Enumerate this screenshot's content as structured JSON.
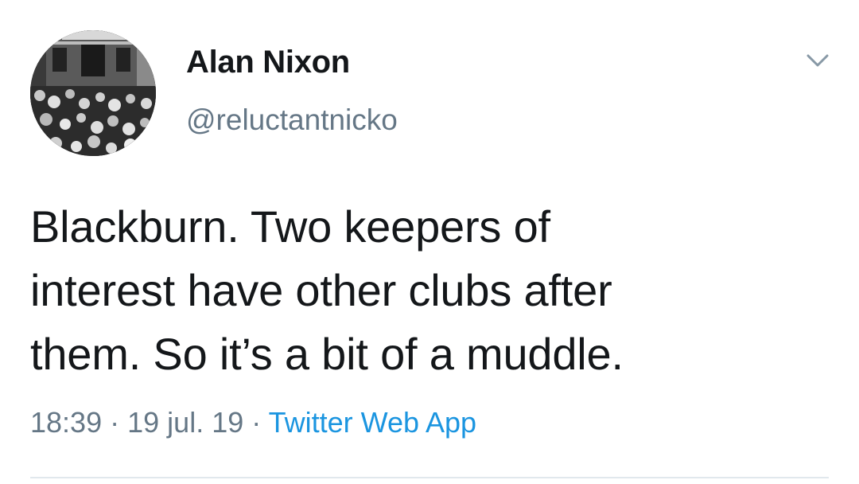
{
  "author": {
    "display_name": "Alan Nixon",
    "handle": "@reluctantnicko"
  },
  "tweet": {
    "text_lines": [
      "Blackburn. Two keepers of",
      "interest have other clubs after",
      "them. So it’s a bit of a muddle."
    ]
  },
  "meta": {
    "time": "18:39",
    "separator": "·",
    "date": "19 jul. 19",
    "source": "Twitter Web App"
  },
  "icons": {
    "menu": "chevron-down-icon",
    "avatar": "avatar-photo"
  },
  "colors": {
    "text": "#14171a",
    "secondary": "#657786",
    "link": "#1b95e0",
    "divider": "#e1e8ed"
  }
}
